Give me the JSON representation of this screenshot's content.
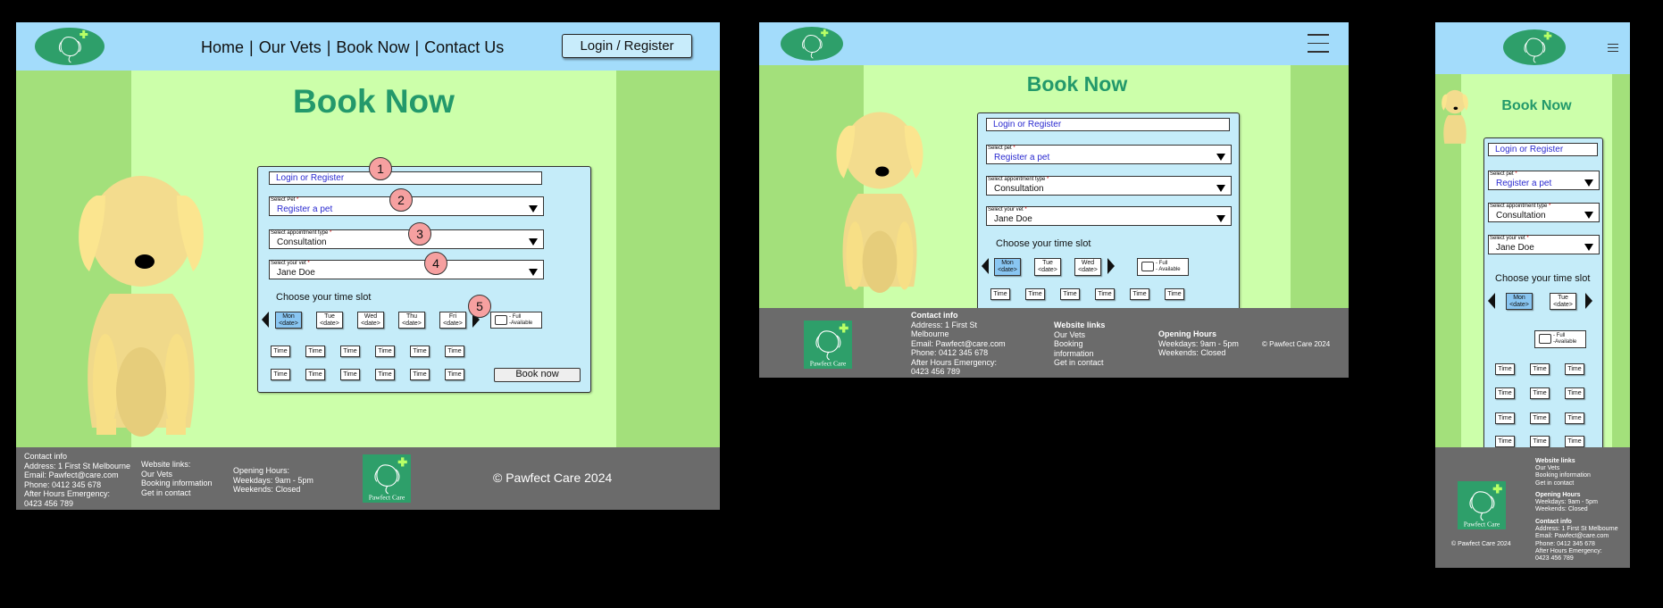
{
  "brand": {
    "name": "Pawfect Care",
    "primary": "#2e9f6a",
    "header_bg": "#a3dcfb",
    "main_bg": "#a3e07b",
    "center_bg": "#ccffaa",
    "footer_bg": "#6b6b6b",
    "title_color": "#23996b"
  },
  "nav": {
    "home": "Home",
    "vets": "Our Vets",
    "book": "Book Now",
    "contact": "Contact Us",
    "login_button": "Login / Register"
  },
  "page_title": "Book Now",
  "form": {
    "login_field": "Login or Register",
    "pet": {
      "label": "Select Pet",
      "label_alt": "Select pet",
      "required": "*",
      "value": "Register a pet"
    },
    "appointment": {
      "label": "Select appointment type",
      "required": "*",
      "value": "Consultation"
    },
    "vet": {
      "label": "Select your vet",
      "required": "*",
      "value": "Jane Doe"
    },
    "timeslot_heading": "Choose your time slot",
    "days": [
      {
        "name": "Mon",
        "date": "<date>"
      },
      {
        "name": "Tue",
        "date": "<date>"
      },
      {
        "name": "Wed",
        "date": "<date>"
      },
      {
        "name": "Thu",
        "date": "<date>"
      },
      {
        "name": "Fri",
        "date": "<date>"
      }
    ],
    "time_label": "Time",
    "legend_full": "- Full",
    "legend_available": "- Available",
    "legend_available_b": "-Available",
    "book_button": "Book now"
  },
  "annotations": [
    "1",
    "2",
    "3",
    "4",
    "5"
  ],
  "footer": {
    "contact_title": "Contact info",
    "address": "Address: 1 First St Melbourne",
    "address_l1": "Address: 1 First St",
    "address_l2": "Melbourne",
    "email": "Email: Pawfect@care.com",
    "phone": "Phone: 0412 345 678",
    "emergency_label": "After Hours Emergency:",
    "emergency_phone": "0423 456 789",
    "links_title": "Website links:",
    "links_title_b": "Website links",
    "links": [
      "Our Vets",
      "Booking information",
      "Get in contact"
    ],
    "link_booking_a": "Booking",
    "link_booking_b": "information",
    "hours_title": "Opening Hours:",
    "hours_title_b": "Opening Hours",
    "weekdays": "Weekdays: 9am - 5pm",
    "weekends": "Weekends: Closed",
    "copyright": "© Pawfect Care 2024",
    "logo_text": "Pawfect Care"
  }
}
